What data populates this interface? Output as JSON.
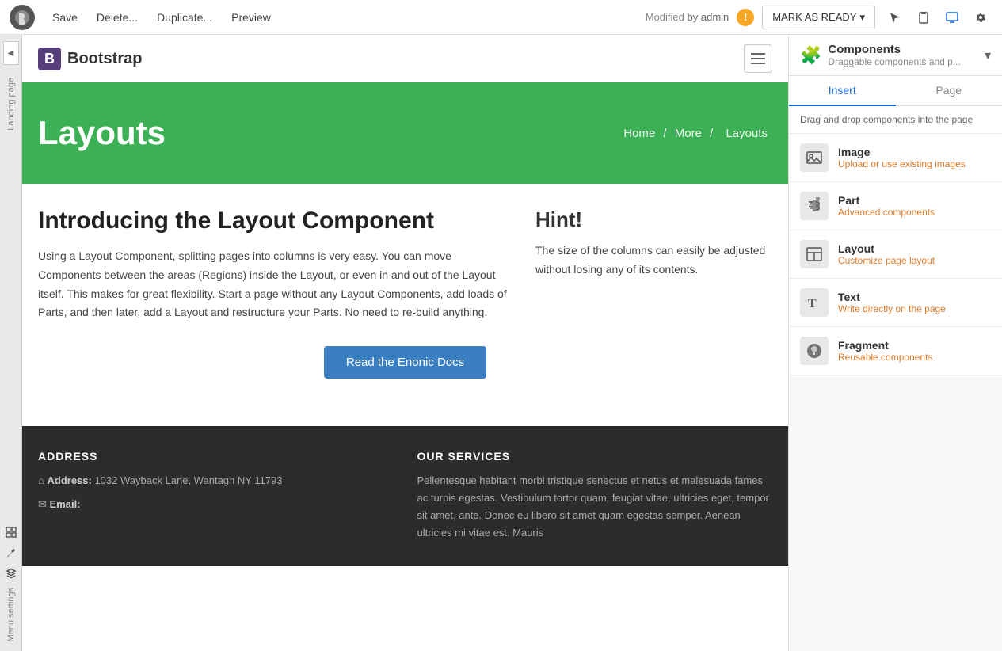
{
  "topbar": {
    "save_label": "Save",
    "delete_label": "Delete...",
    "duplicate_label": "Duplicate...",
    "preview_label": "Preview",
    "modified_text": "Modified",
    "by_text": "by admin",
    "mark_ready_label": "MARK AS READY"
  },
  "left_sidebar": {
    "toggle_label": "◀",
    "label1": "Landing page",
    "label2": "Menu settings"
  },
  "page": {
    "bootstrap_logo_letter": "B",
    "bootstrap_logo_text": "Bootstrap",
    "hero_title": "Layouts",
    "breadcrumb": [
      {
        "label": "Home",
        "href": "#"
      },
      {
        "label": "More",
        "href": "#"
      },
      {
        "label": "Layouts",
        "href": "#"
      }
    ],
    "intro_title": "Introducing the Layout Component",
    "intro_text": "Using a Layout Component, splitting pages into columns is very easy. You can move Components between the areas (Regions) inside the Layout, or even in and out of the Layout itself. This makes for great flexibility. Start a page without any Layout Components, add loads of Parts, and then later, add a Layout and restructure your Parts. No need to re-build anything.",
    "hint_title": "Hint!",
    "hint_text": "The size of the columns can easily be adjusted without losing any of its contents.",
    "btn_enonic": "Read the Enonic Docs",
    "footer_address_title": "ADDRESS",
    "footer_address_label": "Address:",
    "footer_address_value": "1032 Wayback Lane, Wantagh NY 11793",
    "footer_email_label": "Email:",
    "footer_services_title": "OUR SERVICES",
    "footer_services_text": "Pellentesque habitant morbi tristique senectus et netus et malesuada fames ac turpis egestas. Vestibulum tortor quam, feugiat vitae, ultricies eget, tempor sit amet, ante. Donec eu libero sit amet quam egestas semper. Aenean ultricies mi vitae est. Mauris"
  },
  "right_panel": {
    "title": "Components",
    "subtitle": "Draggable components and p...",
    "tab_insert": "Insert",
    "tab_page": "Page",
    "hint_text": "Drag and drop components into the page",
    "components": [
      {
        "id": "image",
        "title": "Image",
        "subtitle": "Upload or use existing images",
        "icon": "image"
      },
      {
        "id": "part",
        "title": "Part",
        "subtitle": "Advanced components",
        "icon": "puzzle"
      },
      {
        "id": "layout",
        "title": "Layout",
        "subtitle": "Customize page layout",
        "icon": "layout"
      },
      {
        "id": "text",
        "title": "Text",
        "subtitle": "Write directly on the page",
        "icon": "text"
      },
      {
        "id": "fragment",
        "title": "Fragment",
        "subtitle": "Reusable components",
        "icon": "fragment"
      }
    ]
  }
}
